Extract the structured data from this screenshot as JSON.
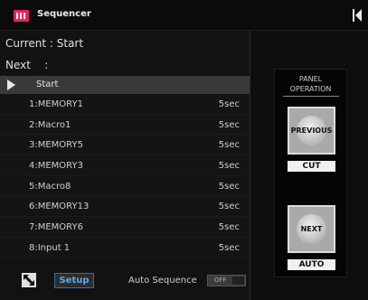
{
  "app": {
    "title": "Sequencer",
    "logo_icon": "sequencer-logo-icon"
  },
  "status": {
    "current_text": "Current : Start",
    "next_text": "Next    :"
  },
  "sequence": {
    "header_label": "Start",
    "items": [
      {
        "name": "1:MEMORY1",
        "duration": "5sec"
      },
      {
        "name": "2:Macro1",
        "duration": "5sec"
      },
      {
        "name": "3:MEMORY5",
        "duration": "5sec"
      },
      {
        "name": "4:MEMORY3",
        "duration": "5sec"
      },
      {
        "name": "5:Macro8",
        "duration": "5sec"
      },
      {
        "name": "6:MEMORY13",
        "duration": "5sec"
      },
      {
        "name": "7:MEMORY6",
        "duration": "5sec"
      },
      {
        "name": "8:Input 1",
        "duration": "5sec"
      }
    ]
  },
  "footer": {
    "setup_label": "Setup",
    "auto_sequence_label": "Auto Sequence",
    "toggle_state": "OFF"
  },
  "panel": {
    "heading_line1": "PANEL",
    "heading_line2": "OPERATION",
    "previous_label": "PREVIOUS",
    "cut_label": "CUT",
    "next_label": "NEXT",
    "auto_label": "AUTO"
  },
  "colors": {
    "accent": "#e2245a",
    "link": "#5ea8ea",
    "background": "#0e0e0e"
  }
}
